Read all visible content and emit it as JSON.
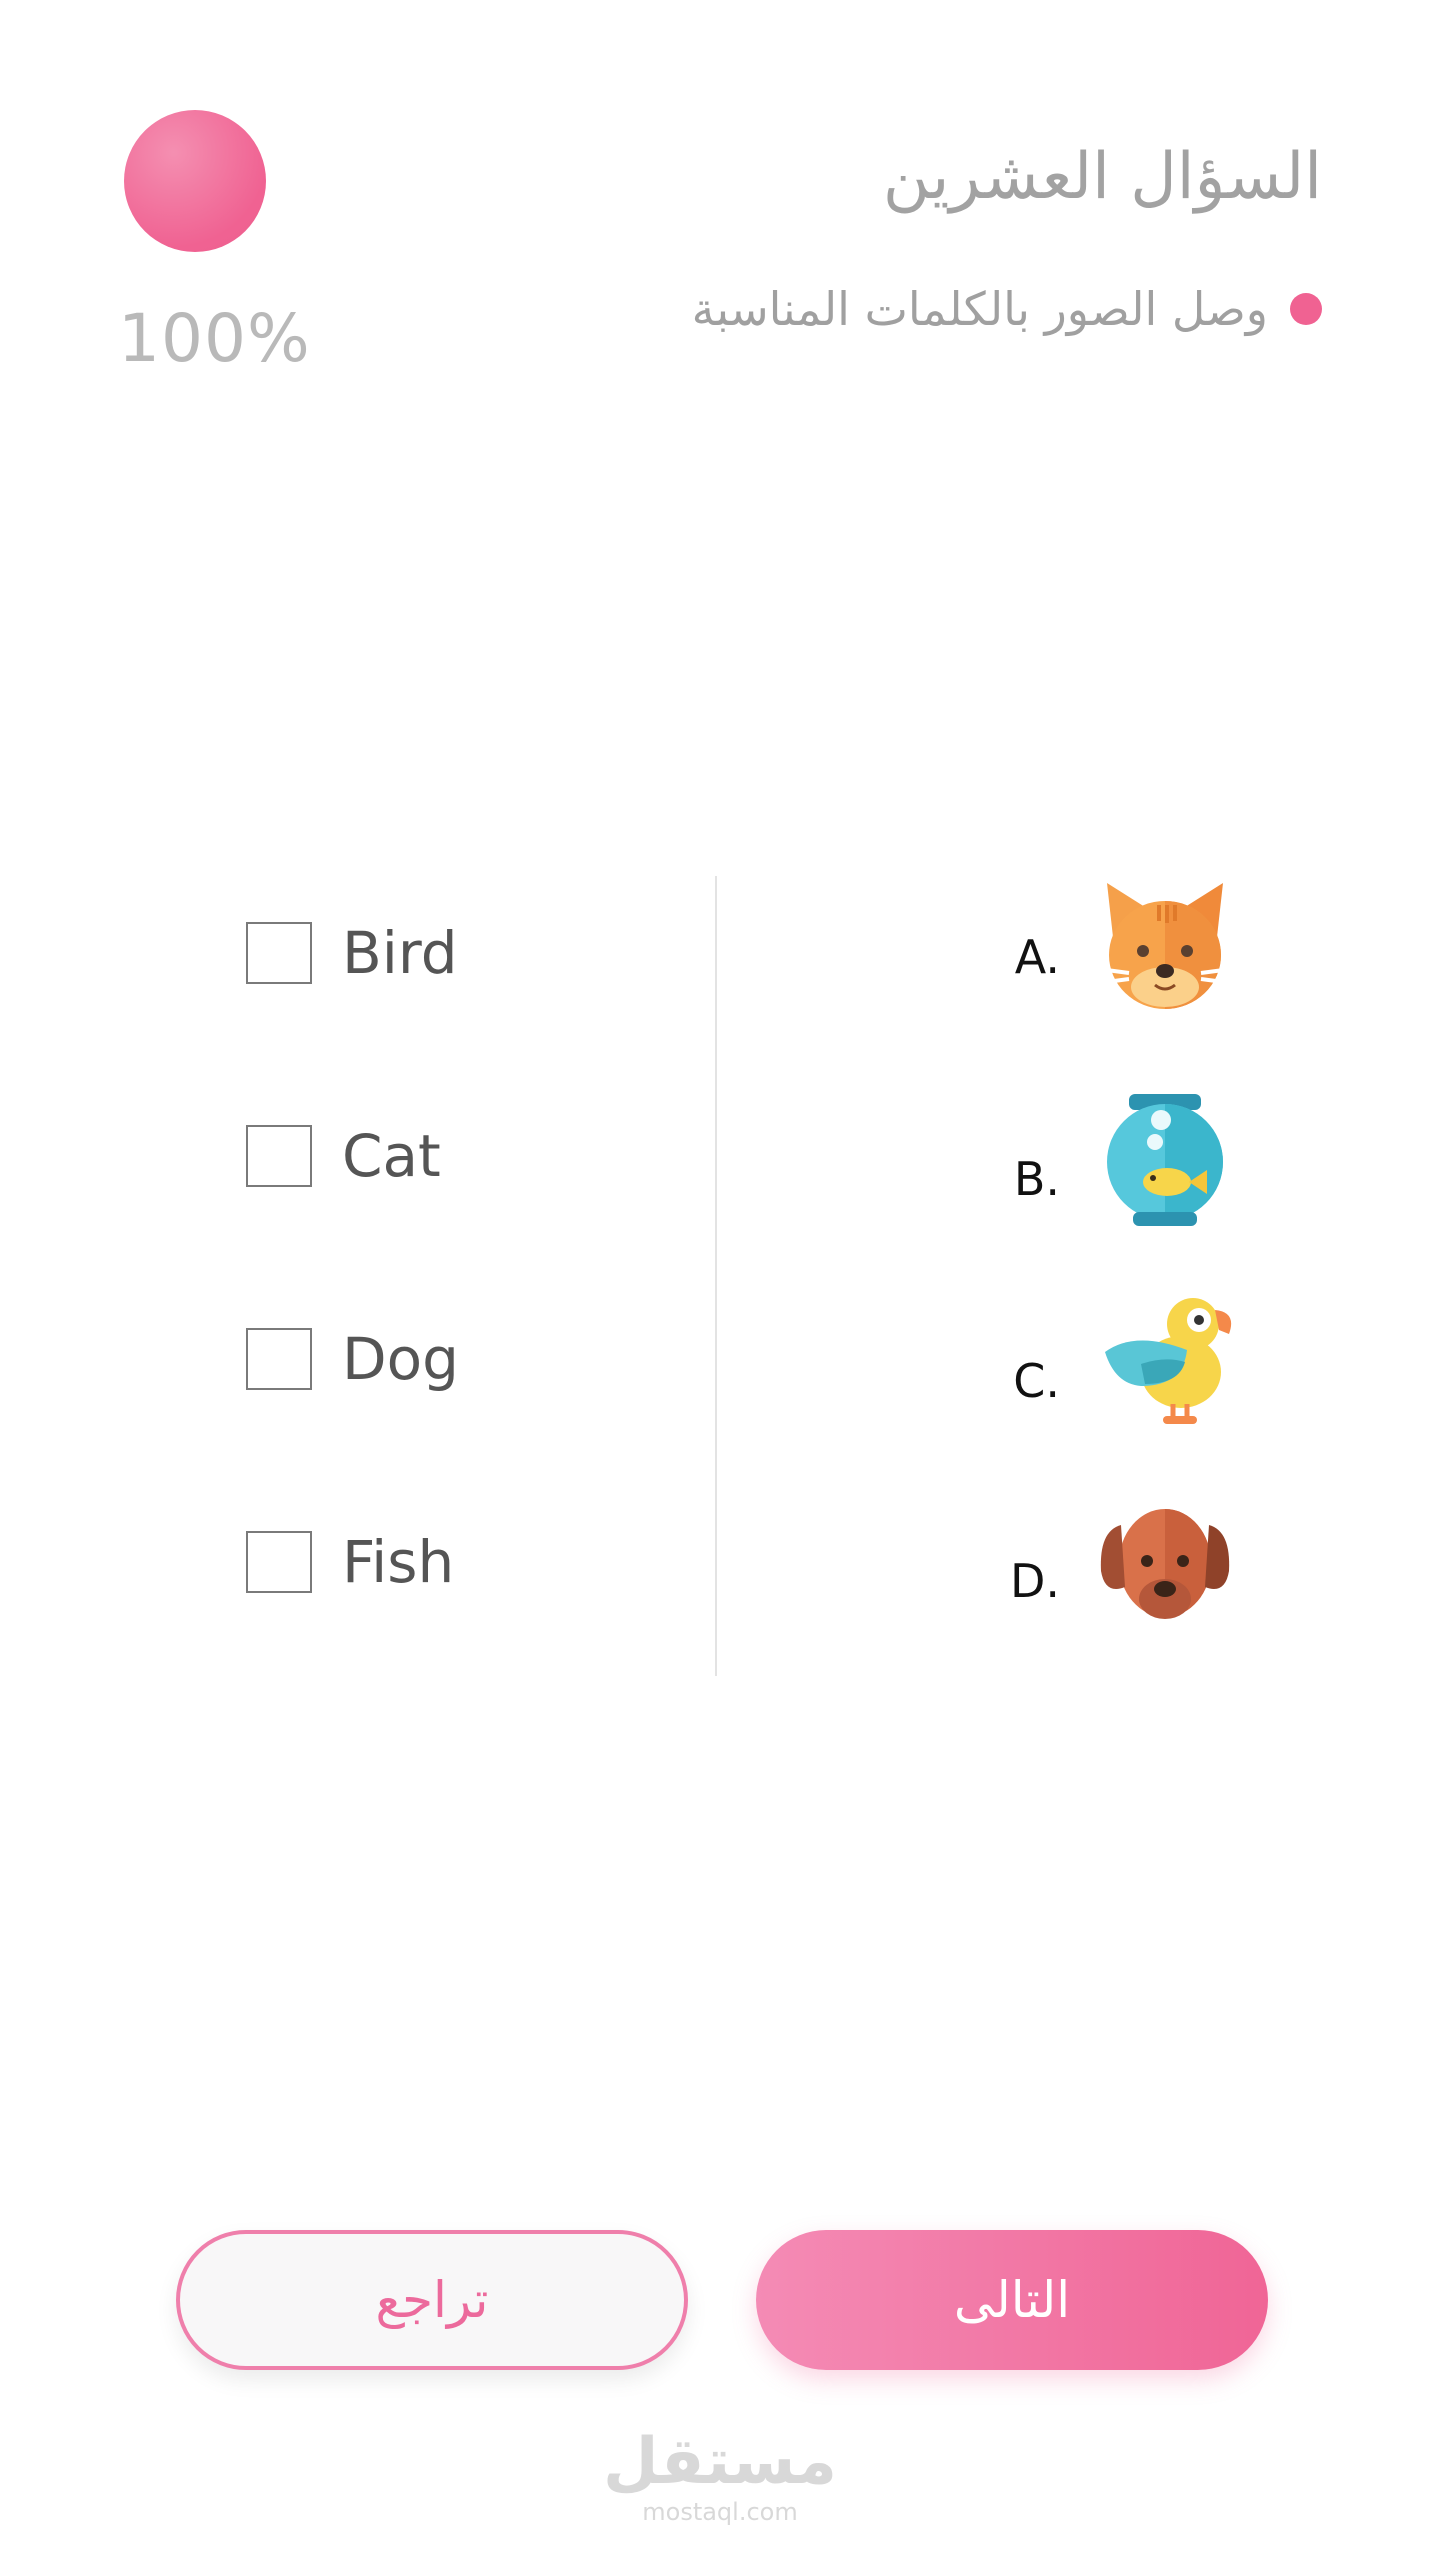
{
  "header": {
    "progress_label": "100%",
    "question_title": "السؤال العشرين",
    "instruction": "وصل الصور بالكلمات المناسبة",
    "accent_color": "#f06292"
  },
  "options": [
    {
      "label": "Bird"
    },
    {
      "label": "Cat"
    },
    {
      "label": "Dog"
    },
    {
      "label": "Fish"
    }
  ],
  "pictures": [
    {
      "letter": "A.",
      "icon": "cat-face-icon"
    },
    {
      "letter": "B.",
      "icon": "fish-bowl-icon"
    },
    {
      "letter": "C.",
      "icon": "parrot-icon"
    },
    {
      "letter": "D.",
      "icon": "dog-face-icon"
    }
  ],
  "buttons": {
    "back_label": "تراجع",
    "next_label": "التالى"
  },
  "watermark": {
    "brand": "مستقل",
    "url": "mostaql.com"
  }
}
